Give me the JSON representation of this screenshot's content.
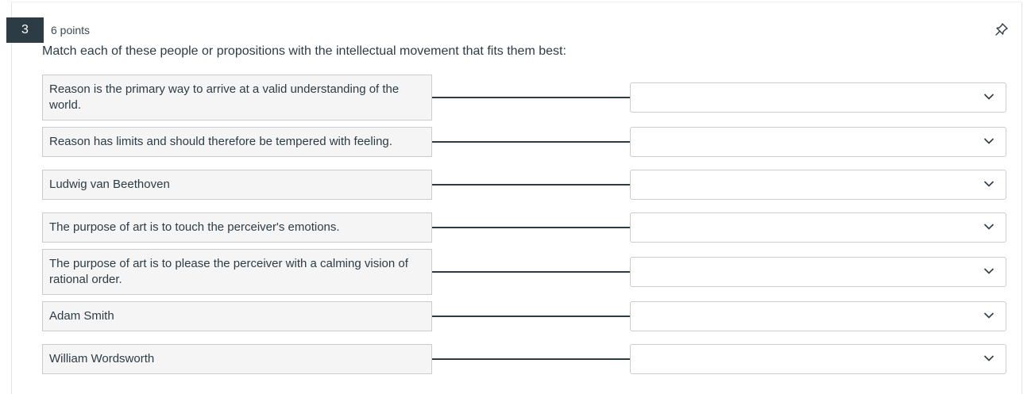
{
  "question": {
    "number": "3",
    "points": "6 points",
    "prompt": "Match each of these people or propositions with the intellectual movement that fits them best:"
  },
  "rows": [
    {
      "text": "Reason is the primary way to arrive at a valid understanding of the world.",
      "selected": ""
    },
    {
      "text": "Reason has limits and should therefore be tempered with feeling.",
      "selected": ""
    },
    {
      "text": "Ludwig van Beethoven",
      "selected": ""
    },
    {
      "text": "The purpose of art is to touch the perceiver's emotions.",
      "selected": ""
    },
    {
      "text": "The purpose of art is to please the perceiver with a calming vision of rational order.",
      "selected": ""
    },
    {
      "text": "Adam Smith",
      "selected": ""
    },
    {
      "text": "William Wordsworth",
      "selected": ""
    }
  ],
  "icons": {
    "pin": "pin-icon",
    "dropdown": "chevron-down-icon"
  },
  "colors": {
    "badge_bg": "#2d3b45",
    "text": "#2d3b45",
    "prompt_box_bg": "#f5f5f5",
    "border": "#c7cdd1"
  }
}
